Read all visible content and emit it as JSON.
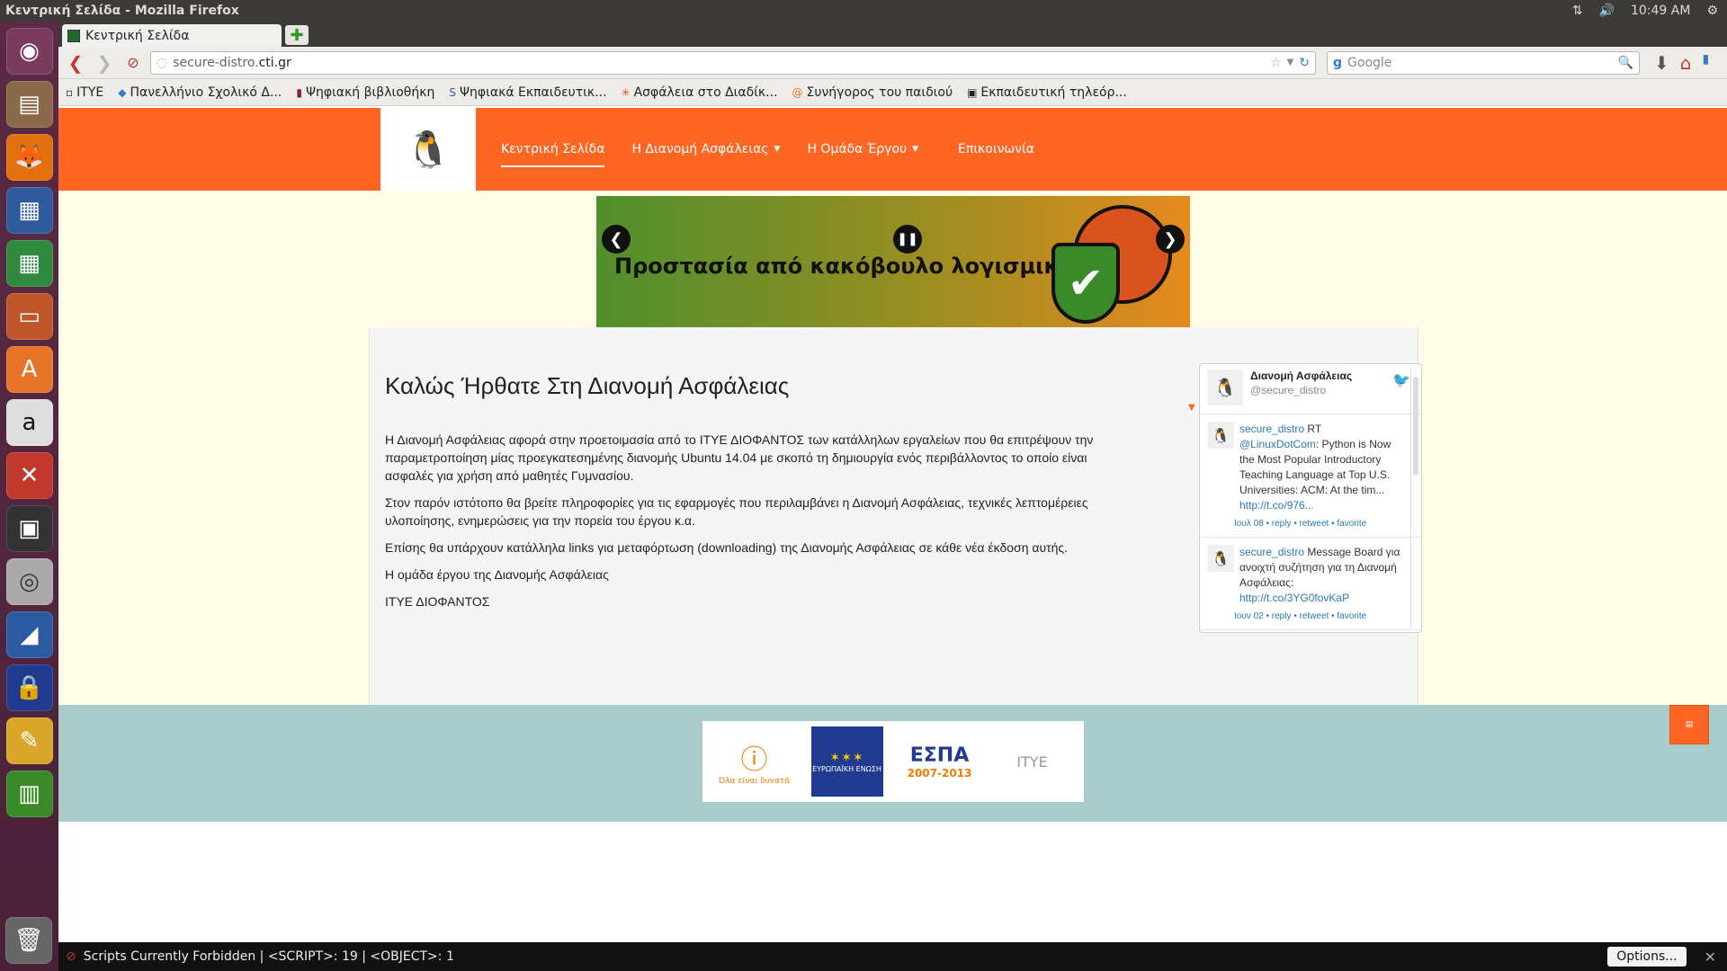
{
  "panel": {
    "window_title": "Κεντρική Σελίδα - Mozilla Firefox",
    "clock": "10:49 AM"
  },
  "launcher": {
    "items": [
      "ubuntu-dash",
      "files",
      "firefox",
      "writer",
      "calc",
      "impress",
      "software-center",
      "amazon",
      "system-settings",
      "save",
      "cd-r",
      "shield",
      "lock",
      "cleaner",
      "monitor",
      "trash"
    ]
  },
  "browser": {
    "tab_title": "Κεντρική Σελίδα",
    "url_prefix": "secure-distro.",
    "url_domain": "cti.gr",
    "search_placeholder": "Google",
    "bookmarks": [
      "ΙΤΥΕ",
      "Πανελλήνιο Σχολικό Δ...",
      "Ψηφιακή βιβλιοθήκη",
      "Ψηφιακά Εκπαιδευτικ...",
      "Ασφάλεια στο Διαδίκ...",
      "Συνήγορος του παιδιού",
      "Εκπαιδευτική τηλεόρ..."
    ]
  },
  "site": {
    "nav": [
      {
        "label": "Κεντρική Σελίδα",
        "active": true
      },
      {
        "label": "Η Διανομή Ασφάλειας",
        "dropdown": true
      },
      {
        "label": "Η Ομάδα Έργου",
        "dropdown": true
      },
      {
        "label": "Επικοινωνία"
      }
    ],
    "banner_caption": "Προστασία από κακόβουλο λογισμικό",
    "article": {
      "title": "Καλώς Ήρθατε Στη Διανομή Ασφάλειας",
      "paragraphs": [
        "Η Διανομή Ασφάλειας αφορά στην προετοιμασία από το ΙΤΥΕ ΔΙΟΦΑΝΤΟΣ των κατάλληλων εργαλείων που θα επιτρέψουν την παραμετροποίηση μίας προεγκατεσημένης διανομής Ubuntu 14.04 με σκοπό τη δημιουργία ενός περιβάλλοντος το οποίο είναι ασφαλές για χρήση από μαθητές Γυμνασίου.",
        "Στον παρόν ιστότοπο θα βρείτε πληροφορίες για τις εφαρμογές που περιλαμβάνει η Διανομή Ασφάλειας, τεχνικές λεπτομέρειες υλοποίησης, ενημερώσεις για την πορεία του έργου κ.α.",
        "Επίσης θα υπάρχουν κατάλληλα links για μεταφόρτωση (downloading) της Διανομής Ασφάλειας σε κάθε νέα έκδοση αυτής.",
        "Η ομάδα έργου της Διανομής Ασφάλειας",
        "ΙΤΥΕ ΔΙΟΦΑΝΤΟΣ"
      ]
    },
    "twitter": {
      "name": "Διανομή Ασφάλειας",
      "handle": "@secure_distro",
      "tweets": [
        {
          "user": "secure_distro",
          "prefix": " RT ",
          "mention": "@LinuxDotCom",
          "text": ": Python is Now the Most Popular Introductory Teaching Language at Top U.S. Universities: ACM: At the tim...",
          "link": "http://t.co/976...",
          "date": "Ιουλ 08",
          "actions": "• reply • retweet • favorite"
        },
        {
          "user": "secure_distro",
          "prefix": " ",
          "mention": "",
          "text": "Message Board για ανοιχτή συζήτηση για τη Διανομή Ασφάλειας: ",
          "link": "http://t.co/3YG0fovKaP",
          "date": "Ιουν 02",
          "actions": "• reply • retweet • favorite"
        }
      ]
    },
    "sponsors": {
      "psifiaki_text": "Όλα είναι δυνατά",
      "eu_text": "ΕΥΡΩΠΑΪΚΗ ΕΝΩΣΗ",
      "espa_text": "ΕΣΠΑ",
      "espa_years": "2007-2013",
      "itye_text": "ΙΤΥΕ"
    }
  },
  "statusbar": {
    "text": "Scripts Currently Forbidden | <SCRIPT>: 19 | <OBJECT>: 1",
    "options_label": "Options..."
  }
}
